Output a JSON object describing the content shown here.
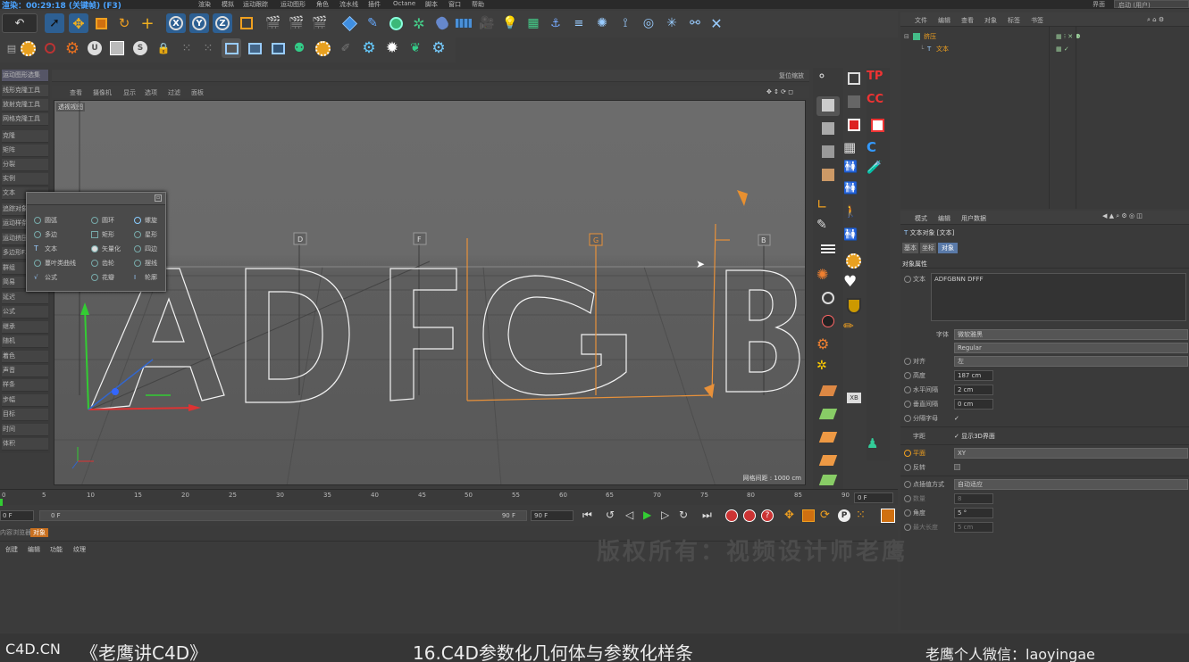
{
  "window": {
    "title": "渲染：00:29:18 (关键帧) (F3)",
    "menu": [
      "渲染",
      "模拟",
      "运动跟踪",
      "运动图形",
      "角色",
      "流水线",
      "插件",
      "Octane",
      "脚本",
      "窗口",
      "帮助"
    ],
    "layout_label": "界面",
    "layout_value": "启动 (用户)"
  },
  "left_panel": {
    "header_items": [
      "运动图形选集",
      "线形克隆工具",
      "放射克隆工具",
      "网格克隆工具"
    ],
    "items": [
      "克隆",
      "矩阵",
      "分裂",
      "实例",
      "文本",
      "追踪对象",
      "运动样条",
      "运动挤压",
      "多边形FX",
      "群组",
      "简易",
      "延迟",
      "公式",
      "继承",
      "随机",
      "着色",
      "声音",
      "样条",
      "步幅",
      "目标",
      "时间",
      "体积"
    ]
  },
  "viewport": {
    "menu": [
      "查看",
      "摄像机",
      "显示",
      "选项",
      "过滤",
      "面板"
    ],
    "label": "透视视图",
    "grid_info": "网格间距 : 1000 cm",
    "text_shown": "ADFGB",
    "markers": [
      "D",
      "F",
      "G",
      "B"
    ]
  },
  "toolbar_row2": {
    "right_label": "复位缩放"
  },
  "spline_popup": {
    "items": [
      "圆弧",
      "圆环",
      "螺旋",
      "多边",
      "矩形",
      "星形",
      "文本",
      "矢量化",
      "四边",
      "蔓叶类曲线",
      "齿轮",
      "摆线",
      "公式",
      "花瓣",
      "轮廓"
    ]
  },
  "object_manager": {
    "menu": [
      "文件",
      "编辑",
      "查看",
      "对象",
      "标签",
      "书签"
    ],
    "objects": [
      {
        "name": "挤压",
        "level": 0,
        "color": "#f0a020"
      },
      {
        "name": "文本",
        "level": 1,
        "color": "#f0a020"
      }
    ]
  },
  "attribute_manager": {
    "menu": [
      "模式",
      "编辑",
      "用户数据"
    ],
    "object_title": "文本对象 [文本]",
    "tabs": [
      "基本",
      "坐标",
      "对象"
    ],
    "active_tab": "对象",
    "section": "对象属性",
    "text_label": "文本",
    "text_value": "ADFGBNN DFFF",
    "font_label": "字体",
    "font_value": "微软雅黑",
    "style_value": "Regular",
    "align_label": "对齐",
    "align_value": "左",
    "height_label": "高度",
    "height_value": "187 cm",
    "hspacing_label": "水平间隔",
    "hspacing_value": "2 cm",
    "vspacing_label": "垂直间隔",
    "vspacing_value": "0 cm",
    "sep_label": "分隔字母",
    "sep_value": "✓",
    "kerning_label": "字距",
    "kerning_check": "显示3D界面",
    "plane_label": "平面",
    "plane_value": "XY",
    "reverse_label": "反转",
    "interp_label": "点插值方式",
    "interp_value": "自动适应",
    "count_label": "数量",
    "count_value": "8",
    "angle_label": "角度",
    "angle_value": "5 °",
    "maxlen_label": "最大长度",
    "maxlen_value": "5 cm"
  },
  "timeline": {
    "ticks": [
      "0",
      "5",
      "10",
      "15",
      "20",
      "25",
      "30",
      "35",
      "40",
      "45",
      "50",
      "55",
      "60",
      "65",
      "70",
      "75",
      "80",
      "85",
      "90"
    ],
    "current_frame": "0 F",
    "start": "0 F",
    "field_start": "0 F",
    "field_end": "90 F",
    "end": "90 F"
  },
  "material": {
    "tabs": [
      "内容浏览器",
      "对象"
    ],
    "menu": [
      "创建",
      "编辑",
      "功能",
      "纹理"
    ]
  },
  "watermark": "版权所有：视频设计师老鹰",
  "caption": {
    "left": "C4D.CN",
    "title": "《老鹰讲C4D》",
    "episode": "16.C4D参数化几何体与参数化样条",
    "contact": "老鹰个人微信：laoyingae"
  }
}
